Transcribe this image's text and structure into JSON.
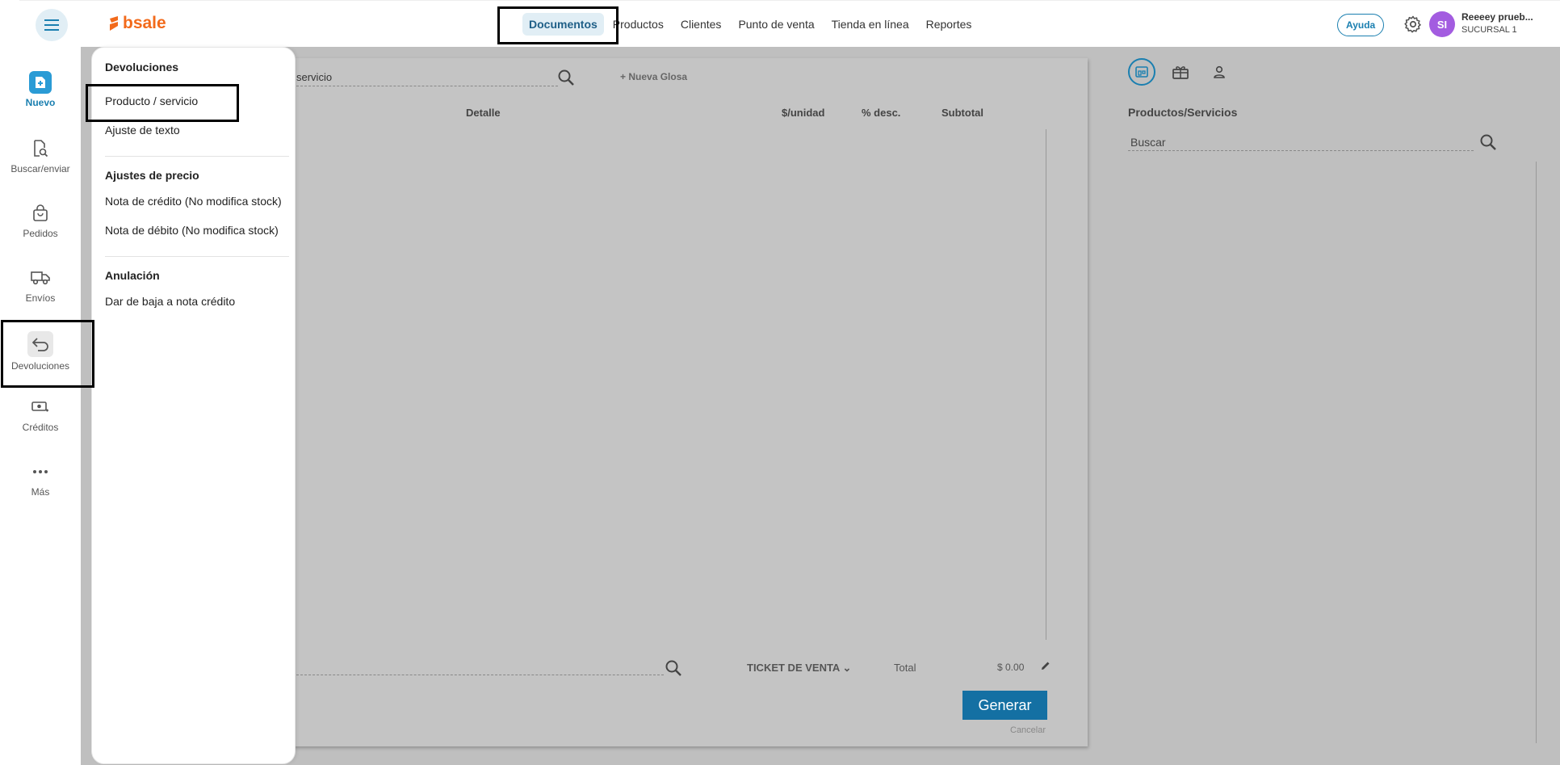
{
  "header": {
    "logo_text": "bsale",
    "nav": [
      "Documentos",
      "Productos",
      "Clientes",
      "Punto de venta",
      "Tienda en línea",
      "Reportes"
    ],
    "help_label": "Ayuda",
    "avatar_initials": "SI",
    "user_name": "Reeeey prueb...",
    "branch": "SUCURSAL 1"
  },
  "sidebar": {
    "items": [
      {
        "label": "Nuevo",
        "icon": "new-doc-icon"
      },
      {
        "label": "Buscar/enviar",
        "icon": "search-doc-icon"
      },
      {
        "label": "Pedidos",
        "icon": "bag-icon"
      },
      {
        "label": "Envíos",
        "icon": "truck-icon"
      },
      {
        "label": "Devoluciones",
        "icon": "return-arrow-icon"
      },
      {
        "label": "Créditos",
        "icon": "money-icon"
      },
      {
        "label": "Más",
        "icon": "more-icon"
      }
    ]
  },
  "dropdown": {
    "sections": [
      {
        "title": "Devoluciones",
        "items": [
          "Producto / servicio",
          "Ajuste de texto"
        ]
      },
      {
        "title": "Ajustes de precio",
        "items": [
          "Nota de crédito (No modifica stock)",
          "Nota de débito (No modifica stock)"
        ]
      },
      {
        "title": "Anulación",
        "items": [
          "Dar de baja a nota crédito"
        ]
      }
    ]
  },
  "document": {
    "search_hint": "servicio",
    "new_gloss": "Nueva Glosa",
    "columns": [
      "Detalle",
      "$/unidad",
      "% desc.",
      "Subtotal"
    ],
    "doc_type": "TICKET DE VENTA",
    "total_label": "Total",
    "total_value": "$ 0.00",
    "generate_label": "Generar",
    "cancel_label": "Cancelar"
  },
  "right_panel": {
    "title": "Productos/Servicios",
    "search_placeholder": "Buscar"
  },
  "colors": {
    "accent": "#1a7fb0",
    "brand_orange": "#f26a1b",
    "overlay_grey": "#bfbfbf",
    "avatar": "#a35ce0",
    "generate_btn": "#1470a3"
  }
}
